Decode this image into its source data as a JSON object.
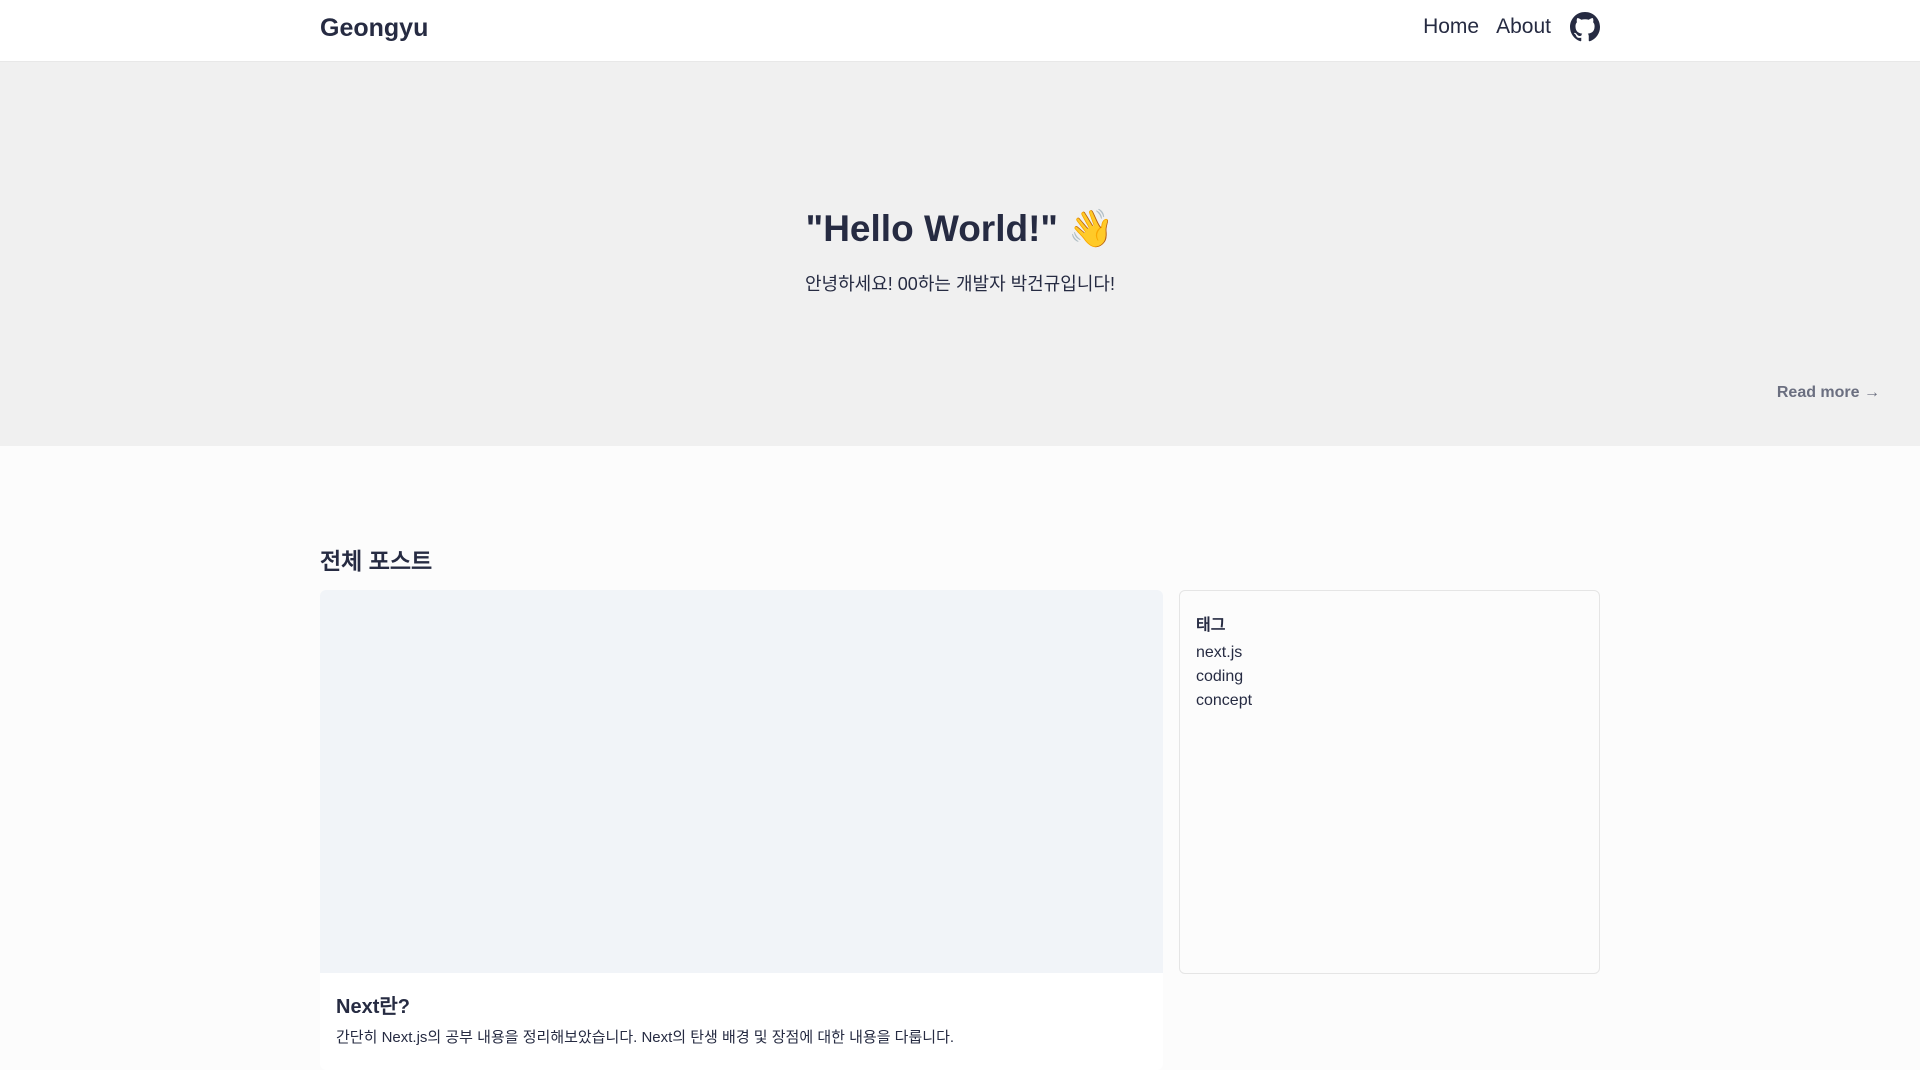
{
  "header": {
    "brand": "Geongyu",
    "nav": [
      {
        "label": "Home"
      },
      {
        "label": "About"
      }
    ],
    "github_icon": "github-icon"
  },
  "hero": {
    "title": "\"Hello World!\" 👋",
    "subtitle": "안녕하세요! 00하는 개발자 박건규입니다!",
    "read_more": "Read more →"
  },
  "posts": {
    "section_title": "전체 포스트",
    "items": [
      {
        "title": "Next란?",
        "description": "간단히 Next.js의 공부 내용을 정리해보았습니다. Next의 탄생 배경 및 장점에 대한 내용을 다룹니다."
      }
    ]
  },
  "tags": {
    "title": "태그",
    "items": [
      "next.js",
      "coding",
      "concept"
    ]
  },
  "colors": {
    "text": "#262b42",
    "hero_bg": "#f0f0f0",
    "thumb_bg": "#f1f4f8",
    "muted": "#6b6f80"
  }
}
